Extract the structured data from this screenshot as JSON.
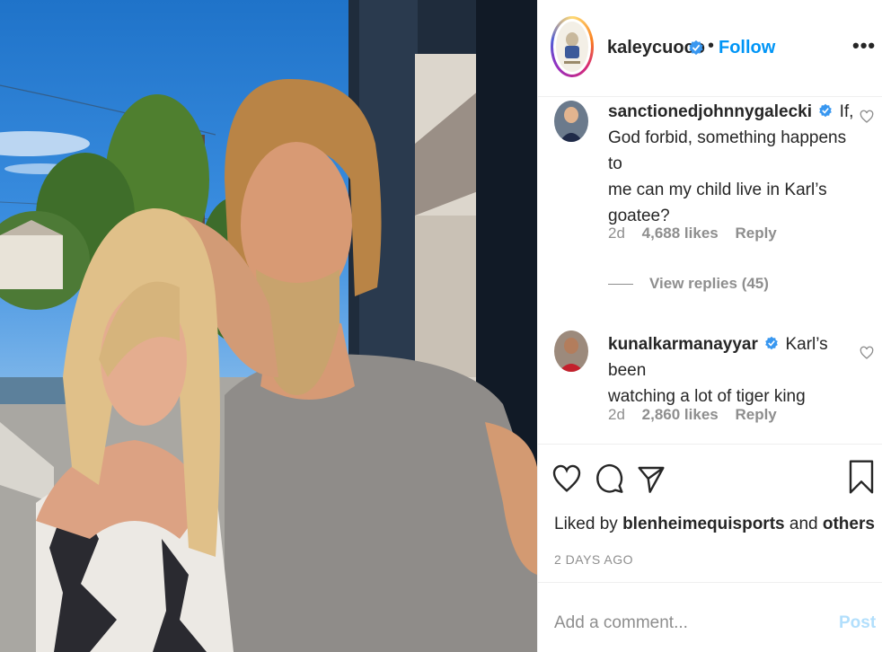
{
  "post": {
    "author": "kaleycuoco",
    "separator": "•",
    "follow_label": "Follow",
    "more_label": "•••"
  },
  "comments": [
    {
      "user": "sanctionedjohnnygalecki",
      "text": "If, God forbid, something happens to me can my child live in Karl’s goatee?",
      "line1": "If,",
      "line2": "God forbid, something happens to",
      "line3": "me can my child live in Karl’s",
      "line4": "goatee?",
      "age": "2d",
      "likes": "4,688 likes",
      "reply_label": "Reply",
      "view_replies": "View replies (45)"
    },
    {
      "user": "kunalkarmanayyar",
      "line1": "Karl’s been",
      "line2": "watching a lot of tiger king",
      "age": "2d",
      "likes": "2,860 likes",
      "reply_label": "Reply"
    }
  ],
  "actions": {
    "liked_prefix": "Liked by",
    "liked_user": "blenheimequisports",
    "liked_and": "and",
    "liked_others": "others",
    "timestamp": "2 DAYS AGO"
  },
  "add_comment": {
    "placeholder": "Add a comment...",
    "post_label": "Post"
  },
  "colors": {
    "link": "#0095f6",
    "muted": "#8e8e8e",
    "post_disabled": "#b2dffc",
    "verified": "#3897f0"
  }
}
